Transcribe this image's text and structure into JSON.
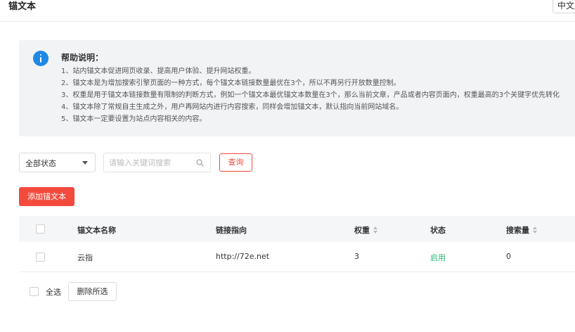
{
  "header": {
    "title": "锚文本",
    "language": "中文版"
  },
  "help": {
    "title": "帮助说明：",
    "items": [
      "1、站内锚文本促进网页收录、提高用户体验、提升网站权重。",
      "2、锚文本是为增加搜索引擎页面的一种方式，每个锚文本链接数量最优在3个，所以不再另行开放数量控制。",
      "3、权重是用于锚文本链接数量有限制的判断方式，例如一个锚文本最优锚文本数量在3个，那么当前文章，产品或者内容页面内，权重最高的3个关键字优先转化",
      "4、锚文本除了常规自主生成之外，用户再网站内进行内容搜索，同样会增加锚文本，默认指向当前网站域名。",
      "5、锚文本一定要设置为站点内容相关的内容。"
    ]
  },
  "filters": {
    "status_value": "全部状态",
    "search_placeholder": "请输入关键词搜索",
    "query_label": "查询"
  },
  "toolbar": {
    "add_label": "添加锚文本"
  },
  "table": {
    "columns": [
      "锚文本名称",
      "链接指向",
      "权重",
      "状态",
      "搜索量"
    ],
    "rows": [
      {
        "name": "云指",
        "link": "http://72e.net",
        "weight": "3",
        "status": "启用",
        "search_count": "0"
      }
    ]
  },
  "footer": {
    "select_all_label": "全选",
    "delete_selected_label": "删除所选"
  },
  "colors": {
    "accent": "#f24b3d",
    "info": "#1e88e5",
    "status_enabled": "#2bb673"
  }
}
